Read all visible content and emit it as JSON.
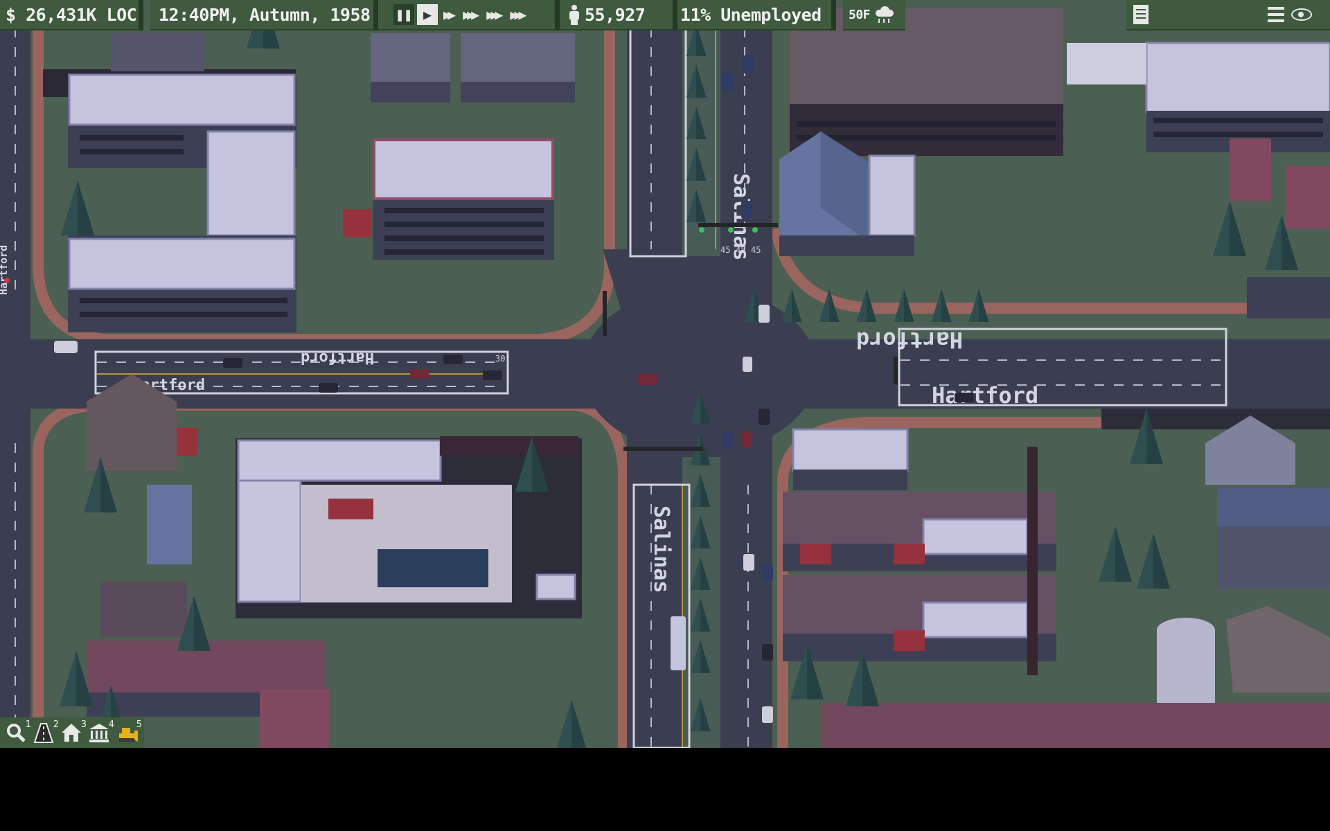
{
  "hud": {
    "money": "$ 26,431K LOC",
    "datetime": "12:40PM, Autumn, 1958",
    "speed": {
      "selected": "play"
    },
    "population": "55,927",
    "unemployment": "11% Unemployed",
    "temperature": "50F"
  },
  "tools": [
    {
      "icon": "magnifier-icon",
      "shortcut": "1"
    },
    {
      "icon": "road-icon",
      "shortcut": "2"
    },
    {
      "icon": "house-icon",
      "shortcut": "3"
    },
    {
      "icon": "government-building-icon",
      "shortcut": "4"
    },
    {
      "icon": "bulldozer-icon",
      "shortcut": "5"
    }
  ],
  "map": {
    "street_hartford_west": "Hartford",
    "street_hartford_west_mirror": "Hartford",
    "street_hartford_east": "Hartford",
    "street_hartford_east_mirror": "Hartford",
    "street_salinas_north": "Salinas",
    "street_salinas_south": "Salinas",
    "street_west_vertical": "Hartford",
    "speed_marks": [
      "45",
      "45",
      "45",
      "30"
    ]
  },
  "colors": {
    "hud_green": "#3f5a3e",
    "grass": "#4e6350",
    "road": "#3c3e4f",
    "dirt_path": "#a86a5e",
    "roof_white": "#d9d7f0",
    "tree": "#2b4c4a"
  }
}
